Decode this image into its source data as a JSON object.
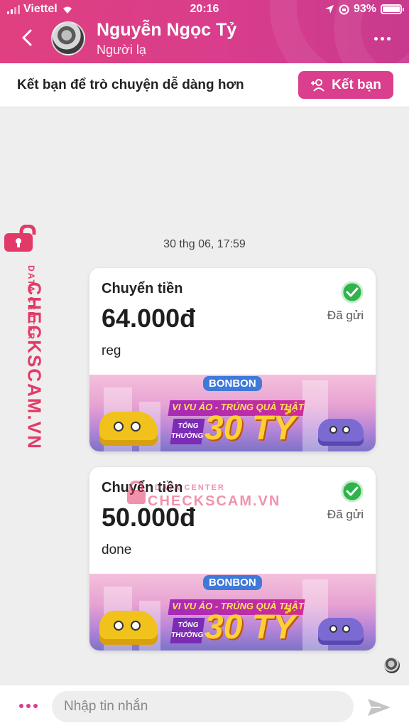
{
  "status_bar": {
    "carrier": "Viettel",
    "time": "20:16",
    "battery": "93%",
    "battery_level": 0.93
  },
  "header": {
    "name": "Nguyễn Ngọc Tỷ",
    "subtitle": "Người lạ"
  },
  "friend_bar": {
    "text": "Kết bạn để trò chuyện dễ dàng hơn",
    "button_label": "Kết bạn"
  },
  "watermark": {
    "brand": "CHECKSCAM.VN",
    "tag": "DATA CENTER"
  },
  "chat": {
    "date": "30 thg 06, 17:59",
    "messages": [
      {
        "title": "Chuyển tiền",
        "amount": "64.000đ",
        "note": "reg",
        "status": "Đã gửi",
        "banner": {
          "logo": "BONBON",
          "headline": "VI VU ẢO - TRÚNG QUÀ THẬT",
          "tong": "TỔNG THƯỞNG",
          "prize": "30 TỶ"
        }
      },
      {
        "title": "Chuyển tiền",
        "amount": "50.000đ",
        "note": "done",
        "status": "Đã gửi",
        "banner": {
          "logo": "BONBON",
          "headline": "VI VU ẢO - TRÚNG QUÀ THẬT",
          "tong": "TỔNG THƯỞNG",
          "prize": "30 TỶ"
        }
      }
    ]
  },
  "input": {
    "placeholder": "Nhập tin nhắn"
  },
  "colors": {
    "accent": "#d93d8c",
    "success": "#2fb34a",
    "watermark": "#e23a68"
  }
}
